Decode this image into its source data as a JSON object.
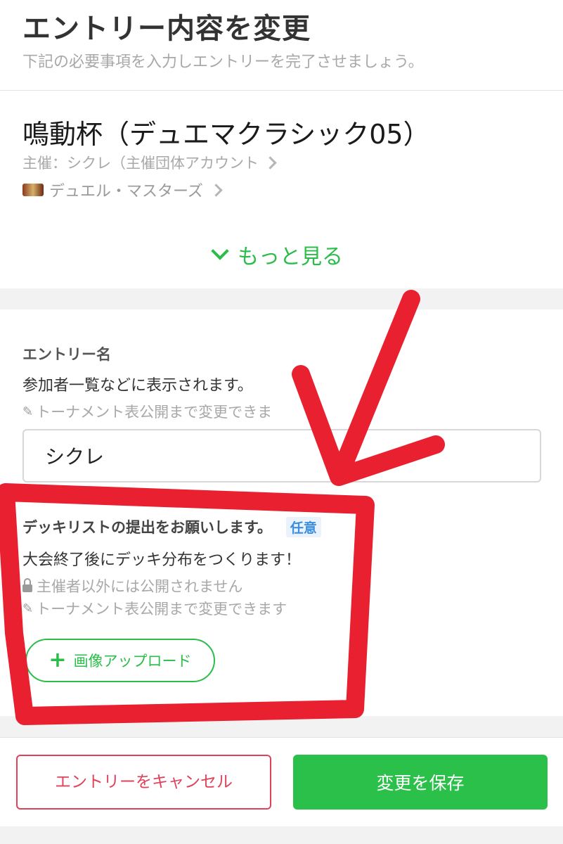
{
  "header": {
    "title": "エントリー内容を変更",
    "subtitle": "下記の必要事項を入力しエントリーを完了させましょう。"
  },
  "event": {
    "name": "鳴動杯（デュエマクラシック05）",
    "organizer": "主催：シクレ（主催団体アカウント",
    "game": "デュエル・マスターズ",
    "more_label": "もっと見る"
  },
  "entry_name": {
    "label": "エントリー名",
    "description": "参加者一覧などに表示されます。",
    "note": "トーナメント表公開まで変更できま",
    "value": "シクレ"
  },
  "deck_list": {
    "label": "デッキリストの提出をお願いします。",
    "badge": "任意",
    "description": "大会終了後にデッキ分布をつくります！",
    "privacy_note": "主催者以外には公開されません",
    "edit_note": "トーナメント表公開まで変更できます",
    "upload_label": "画像アップロード"
  },
  "footer": {
    "cancel_label": "エントリーをキャンセル",
    "save_label": "変更を保存"
  },
  "colors": {
    "accent_green": "#2bbd4a",
    "cancel_red": "#e0425a",
    "annotation_red": "#e8202f",
    "badge_blue": "#3b8ee0"
  },
  "icons": [
    "chevron-right-icon",
    "chevron-down-icon",
    "pencil-icon",
    "lock-icon",
    "plus-icon",
    "game-logo"
  ]
}
